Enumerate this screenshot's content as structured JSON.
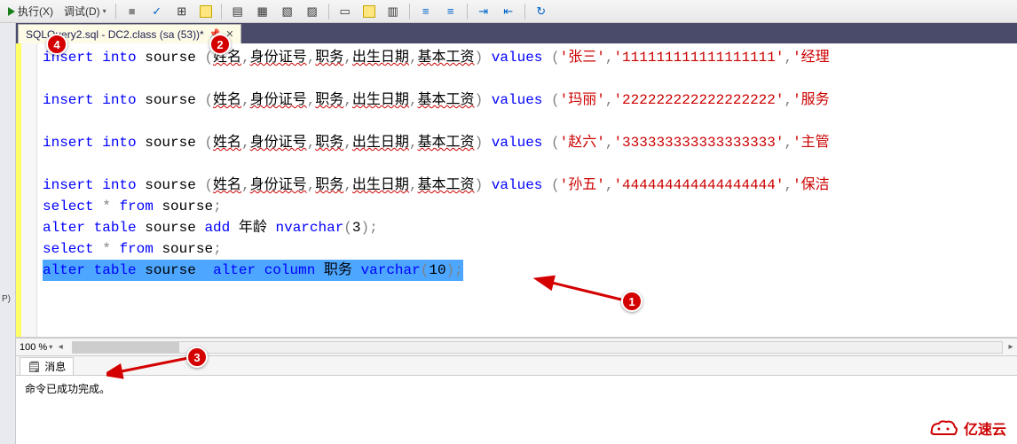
{
  "toolbar": {
    "execute_label": "执行(X)",
    "debug_label": "调试(D)"
  },
  "tab": {
    "title": "SQLQuery2.sql - DC2.class (sa (53))*"
  },
  "code": {
    "lines": [
      {
        "type": "insert",
        "name": "张三",
        "id": "111111111111111111",
        "job": "经理"
      },
      {
        "type": "blank"
      },
      {
        "type": "insert",
        "name": "玛丽",
        "id": "222222222222222222",
        "job": "服务"
      },
      {
        "type": "blank"
      },
      {
        "type": "insert",
        "name": "赵六",
        "id": "333333333333333333",
        "job": "主管"
      },
      {
        "type": "blank"
      },
      {
        "type": "insert",
        "name": "孙五",
        "id": "444444444444444444",
        "job": "保洁"
      },
      {
        "type": "select"
      },
      {
        "type": "alter_add",
        "col": "年龄",
        "dtype": "nvarchar",
        "len": "3"
      },
      {
        "type": "select"
      },
      {
        "type": "alter_column",
        "col": "职务",
        "dtype": "varchar",
        "len": "10",
        "highlighted": true
      }
    ],
    "insert_cols": "姓名,身份证号,职务,出生日期,基本工资",
    "table_name": "sourse"
  },
  "zoom": {
    "value": "100 %"
  },
  "messages": {
    "tab_label": "消息",
    "body": "命令已成功完成。"
  },
  "left_panel": {
    "label": "P)"
  },
  "badges": {
    "b1": "1",
    "b2": "2",
    "b3": "3",
    "b4": "4"
  },
  "watermark": {
    "text": "亿速云"
  }
}
